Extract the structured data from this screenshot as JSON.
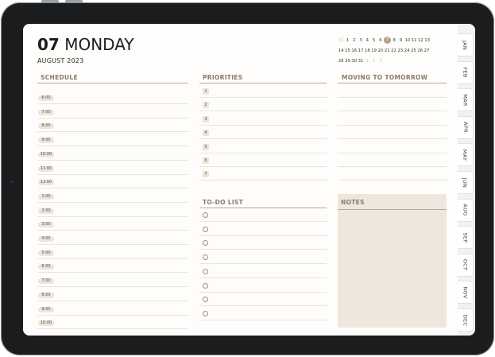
{
  "date": {
    "day_number": "07",
    "weekday": "MONDAY",
    "month_year": "AUGUST 2023"
  },
  "mini_calendar": {
    "rows": [
      [
        {
          "t": "31",
          "dim": true
        },
        {
          "t": "1"
        },
        {
          "t": "2"
        },
        {
          "t": "3"
        },
        {
          "t": "4"
        },
        {
          "t": "5"
        },
        {
          "t": "6"
        },
        {
          "t": "7",
          "sel": true
        },
        {
          "t": "8"
        },
        {
          "t": "9"
        },
        {
          "t": "10"
        },
        {
          "t": "11"
        },
        {
          "t": "12"
        },
        {
          "t": "13"
        }
      ],
      [
        {
          "t": "14"
        },
        {
          "t": "15"
        },
        {
          "t": "16"
        },
        {
          "t": "17"
        },
        {
          "t": "18"
        },
        {
          "t": "19"
        },
        {
          "t": "20"
        },
        {
          "t": "21"
        },
        {
          "t": "22"
        },
        {
          "t": "23"
        },
        {
          "t": "24"
        },
        {
          "t": "25"
        },
        {
          "t": "26"
        },
        {
          "t": "27"
        }
      ],
      [
        {
          "t": "28"
        },
        {
          "t": "29"
        },
        {
          "t": "30"
        },
        {
          "t": "31"
        },
        {
          "t": "1",
          "dim": true
        },
        {
          "t": "2",
          "dim": true
        },
        {
          "t": "3",
          "dim": true
        }
      ]
    ]
  },
  "schedule": {
    "header": "SCHEDULE",
    "times": [
      "6:00",
      "7:00",
      "8:00",
      "9:00",
      "10:00",
      "11:00",
      "12:00",
      "1:00",
      "2:00",
      "3:00",
      "4:00",
      "5:00",
      "6:00",
      "7:00",
      "8:00",
      "9:00",
      "10:00"
    ]
  },
  "priorities": {
    "header": "PRIORITIES",
    "numbers": [
      "1",
      "2",
      "3",
      "4",
      "5",
      "6",
      "7"
    ]
  },
  "moving": {
    "header": "MOVING TO TOMORROW"
  },
  "todo": {
    "header": "TO-DO LIST",
    "count": 8
  },
  "notes": {
    "header": "NOTES"
  },
  "months": [
    "JAN",
    "FEB",
    "MAR",
    "APR",
    "MAY",
    "JUN",
    "AUG",
    "SEP",
    "OCT",
    "NOV",
    "DEC"
  ]
}
